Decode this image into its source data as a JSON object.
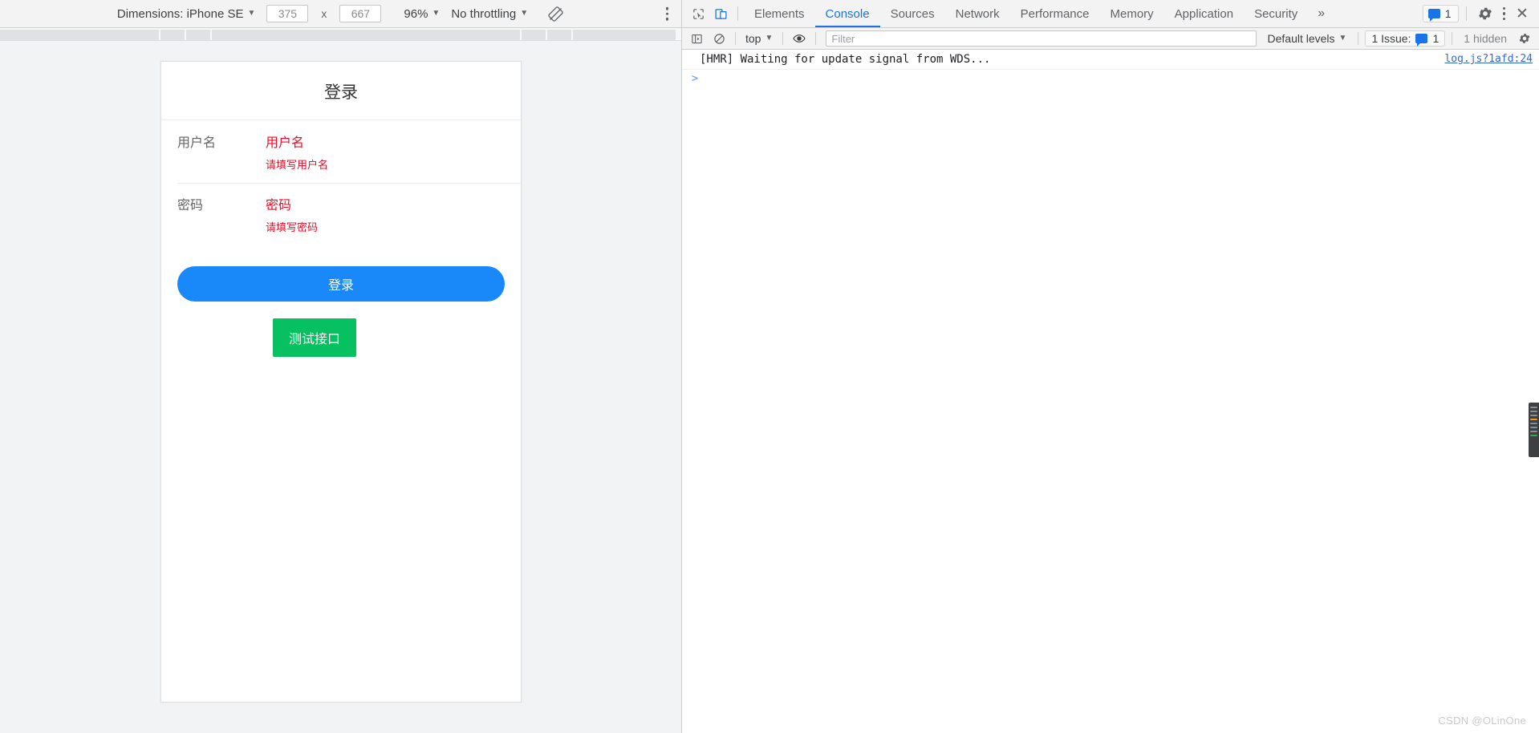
{
  "device_toolbar": {
    "dimensions_label": "Dimensions: iPhone SE",
    "width_value": "375",
    "multiply_symbol": "x",
    "height_value": "667",
    "zoom_label": "96%",
    "throttling_label": "No throttling",
    "rotate_icon": "rotate-icon",
    "more_icon": "kebab-menu-icon"
  },
  "mobile_page": {
    "title": "登录",
    "fields": [
      {
        "label": "用户名",
        "value": "用户名",
        "error": "请填写用户名"
      },
      {
        "label": "密码",
        "value": "密码",
        "error": "请填写密码"
      }
    ],
    "submit_button": "登录",
    "test_button": "测试接口",
    "colors": {
      "primary": "#1989fa",
      "success": "#07c160",
      "danger": "#ee0a24",
      "label": "#646566"
    }
  },
  "devtools": {
    "inspect_icon": "inspect-cursor-icon",
    "device_toggle_icon": "device-toolbar-icon",
    "tabs": [
      {
        "label": "Elements",
        "active": false
      },
      {
        "label": "Console",
        "active": true
      },
      {
        "label": "Sources",
        "active": false
      },
      {
        "label": "Network",
        "active": false
      },
      {
        "label": "Performance",
        "active": false
      },
      {
        "label": "Memory",
        "active": false
      },
      {
        "label": "Application",
        "active": false
      },
      {
        "label": "Security",
        "active": false
      }
    ],
    "more_tabs_label": "»",
    "message_count": "1",
    "settings_icon": "gear-icon",
    "main_menu_icon": "kebab-menu-icon",
    "close_icon": "close-icon"
  },
  "console_toolbar": {
    "sidebar_icon": "console-sidebar-icon",
    "clear_icon": "clear-console-icon",
    "context_label": "top",
    "eye_icon": "live-expression-icon",
    "filter_placeholder": "Filter",
    "filter_value": "",
    "levels_label": "Default levels",
    "issues_label": "1 Issue:",
    "issues_count": "1",
    "hidden_label": "1 hidden",
    "settings_icon": "gear-icon"
  },
  "console": {
    "messages": [
      {
        "text": "[HMR] Waiting for update signal from WDS...",
        "source": "log.js?1afd:24"
      }
    ],
    "prompt_symbol": ">",
    "prompt_value": ""
  },
  "watermark": "CSDN @OLinOne"
}
